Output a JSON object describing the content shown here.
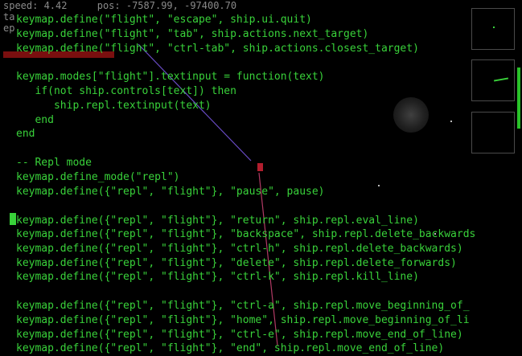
{
  "hud": {
    "speed": "speed: 4.42",
    "pos": "pos: -7587.99, -97400.70",
    "line3": "ta",
    "line4": "ep"
  },
  "code_lines": [
    "keymap.define(\"flight\", \"escape\", ship.ui.quit)",
    "keymap.define(\"flight\", \"tab\", ship.actions.next_target)",
    "keymap.define(\"flight\", \"ctrl-tab\", ship.actions.closest_target)",
    "",
    "keymap.modes[\"flight\"].textinput = function(text)",
    "   if(not ship.controls[text]) then",
    "      ship.repl.textinput(text)",
    "   end",
    "end",
    "",
    "-- Repl mode",
    "keymap.define_mode(\"repl\")",
    "keymap.define({\"repl\", \"flight\"}, \"pause\", pause)",
    "",
    "keymap.define({\"repl\", \"flight\"}, \"return\", ship.repl.eval_line)",
    "keymap.define({\"repl\", \"flight\"}, \"backspace\", ship.repl.delete_backwards",
    "keymap.define({\"repl\", \"flight\"}, \"ctrl-h\", ship.repl.delete_backwards)",
    "keymap.define({\"repl\", \"flight\"}, \"delete\", ship.repl.delete_forwards)",
    "keymap.define({\"repl\", \"flight\"}, \"ctrl-k\", ship.repl.kill_line)",
    "",
    "keymap.define({\"repl\", \"flight\"}, \"ctrl-a\", ship.repl.move_beginning_of_",
    "keymap.define({\"repl\", \"flight\"}, \"home\", ship.repl.move_beginning_of_li",
    "keymap.define({\"repl\", \"flight\"}, \"ctrl-e\", ship.repl.move_end_of_line)",
    "keymap.define({\"repl\", \"flight\"}, \"end\", ship.repl.move_end_of_line)"
  ],
  "cursor_line": 14,
  "colors": {
    "code": "#39d23a",
    "hud": "#8a8a8a",
    "background": "#000000"
  }
}
